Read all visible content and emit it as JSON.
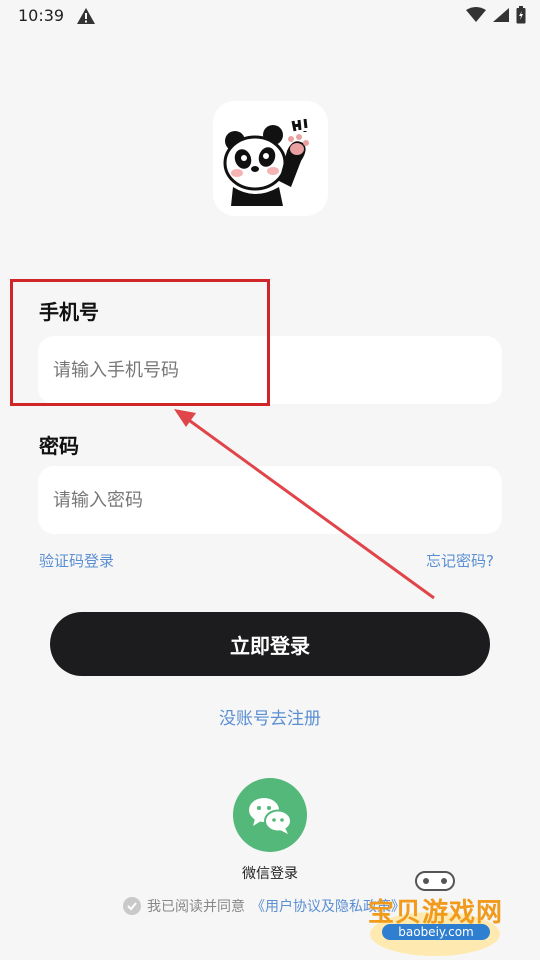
{
  "status_bar": {
    "time": "10:39"
  },
  "form": {
    "phone_label": "手机号",
    "phone_placeholder": "请输入手机号码",
    "phone_value": "",
    "password_label": "密码",
    "password_placeholder": "请输入密码",
    "password_value": "",
    "sms_login_link": "验证码登录",
    "forgot_password_link": "忘记密码?"
  },
  "actions": {
    "login_button": "立即登录",
    "register_link": "没账号去注册",
    "wechat_label": "微信登录"
  },
  "agreement": {
    "text": "我已阅读并同意",
    "link": "《用户协议及隐私政策》"
  },
  "watermark": {
    "title": "宝贝游戏网",
    "url": "baobeiy.com"
  },
  "colors": {
    "background": "#f6f6f6",
    "primary_button": "#1c1c1e",
    "link": "#5b8fd3",
    "wechat_green": "#53b879",
    "annotation_red": "#d0262a"
  },
  "icons": {
    "warning": "warning-icon",
    "wifi": "wifi-icon",
    "signal": "signal-icon",
    "battery": "battery-icon",
    "logo": "panda-logo",
    "wechat": "wechat-icon",
    "check": "check-icon"
  }
}
